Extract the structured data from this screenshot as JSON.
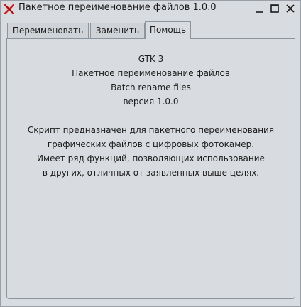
{
  "window": {
    "title": "Пакетное переименование файлов 1.0.0"
  },
  "icons": {
    "app": "x-icon",
    "minimize": "minimize-icon",
    "maximize": "maximize-icon",
    "close": "close-icon"
  },
  "tabs": [
    {
      "label": "Переименовать",
      "active": false
    },
    {
      "label": "Заменить",
      "active": false
    },
    {
      "label": "Помощь",
      "active": true
    }
  ],
  "help": {
    "lines": [
      "GTK 3",
      "Пакетное переименование файлов",
      "Batch rename files",
      "версия 1.0.0",
      "",
      "Скрипт предназначен для пакетного переименования",
      "графических файлов с цифровых фотокамер.",
      "Имеет ряд функций, позволяющих использование",
      "в других, отличных от заявленных выше целях."
    ]
  },
  "colors": {
    "background": "#d8dce1",
    "border": "#8e949b",
    "app_icon": "#d11a1a"
  }
}
